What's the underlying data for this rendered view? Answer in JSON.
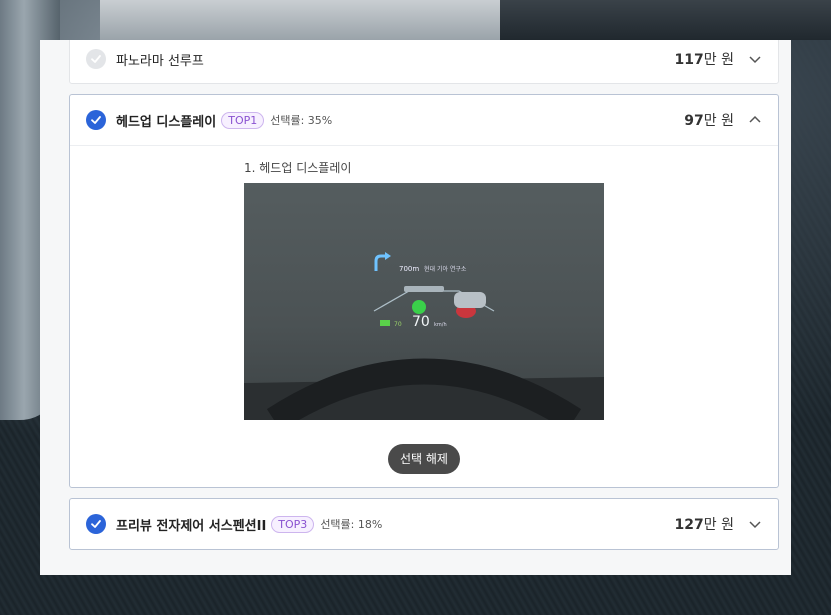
{
  "options": [
    {
      "id": "panorama",
      "label": "파노라마 선루프",
      "selected": false,
      "expanded": false,
      "price_num": "117",
      "price_unit": "만 원"
    },
    {
      "id": "hud",
      "label": "헤드업 디스플레이",
      "selected": true,
      "expanded": true,
      "badge": "TOP1",
      "rate": "선택률: 35%",
      "price_num": "97",
      "price_unit": "만 원",
      "detail_title": "1. 헤드업 디스플레이",
      "deselect_label": "선택 해제",
      "hud": {
        "distance": "700m",
        "place": "현대 기아 연구소",
        "speed": "70",
        "speed_unit": "km/h",
        "limit": "70"
      }
    },
    {
      "id": "suspension",
      "label": "프리뷰 전자제어 서스펜션II",
      "selected": true,
      "expanded": false,
      "badge": "TOP3",
      "rate": "선택률: 18%",
      "price_num": "127",
      "price_unit": "만 원"
    }
  ],
  "colors": {
    "check_on": "#2b64d9",
    "badge_text": "#8a52d0",
    "deselect_bg": "#4a4a4a"
  },
  "icons": {
    "check": "check-icon",
    "chevron_down": "chevron-down-icon",
    "chevron_up": "chevron-up-icon"
  }
}
